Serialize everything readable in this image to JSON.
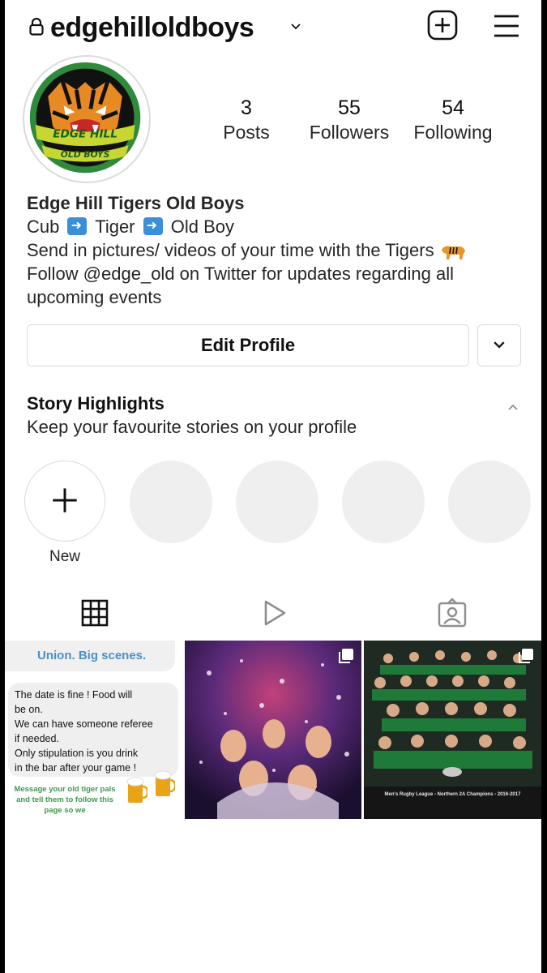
{
  "header": {
    "username": "edgehilloldboys",
    "icons": [
      "lock-icon",
      "chevron-down-icon",
      "new-post-icon",
      "menu-icon"
    ]
  },
  "avatar": {
    "text_line1": "EDGE HILL",
    "text_line2": "OLD BOYS"
  },
  "stats": [
    {
      "value": "3",
      "label": "Posts"
    },
    {
      "value": "55",
      "label": "Followers"
    },
    {
      "value": "54",
      "label": "Following"
    }
  ],
  "bio": {
    "name": "Edge Hill Tigers Old Boys",
    "line1": {
      "part1": "Cub",
      "part2": "Tiger",
      "part3": "Old Boy"
    },
    "line2": "Send in pictures/ videos of your time with the Tigers",
    "line3": "Follow @edge_old on Twitter for updates regarding all",
    "line4": "upcoming events"
  },
  "actions": {
    "edit_profile": "Edit Profile"
  },
  "highlights": {
    "title": "Story Highlights",
    "subtitle": "Keep your favourite stories on your profile",
    "new_label": "New"
  },
  "tabs": [
    "grid-icon",
    "reels-icon",
    "tagged-icon"
  ],
  "posts": {
    "post1": {
      "header": "Union. Big scenes.",
      "lines": [
        "The date is fine ! Food will",
        "be on.",
        "We can have someone referee",
        "if needed.",
        "Only stipulation is you drink",
        "in the bar after your game !"
      ],
      "footer": "Message your old tiger pals and tell them to follow this page so we"
    },
    "post3": {
      "caption": "Men's Rugby League - Northern 2A Champions - 2016-2017"
    }
  },
  "colors": {
    "accent": "#3a8fd8",
    "divider": "#dbdbdb",
    "placeholder": "#efefef"
  }
}
